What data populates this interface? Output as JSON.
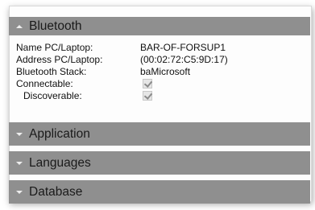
{
  "sections": {
    "bluetooth": {
      "title": "Bluetooth",
      "state": "expanded"
    },
    "application": {
      "title": "Application",
      "state": "collapsed"
    },
    "languages": {
      "title": "Languages",
      "state": "collapsed"
    },
    "database": {
      "title": "Database",
      "state": "collapsed"
    }
  },
  "bluetooth_fields": {
    "name_label": "Name PC/Laptop:",
    "name_value": "BAR-OF-FORSUP1",
    "address_label": "Address PC/Laptop:",
    "address_value": "(00:02:72:C5:9D:17)",
    "stack_label": "Bluetooth Stack:",
    "stack_value": "baMicrosoft",
    "connectable_label": "Connectable:",
    "connectable_checked": true,
    "discoverable_label": "Discoverable:",
    "discoverable_checked": true
  },
  "colors": {
    "header_bg": "#8f8f8f",
    "header_text": "#1a1a1a"
  }
}
